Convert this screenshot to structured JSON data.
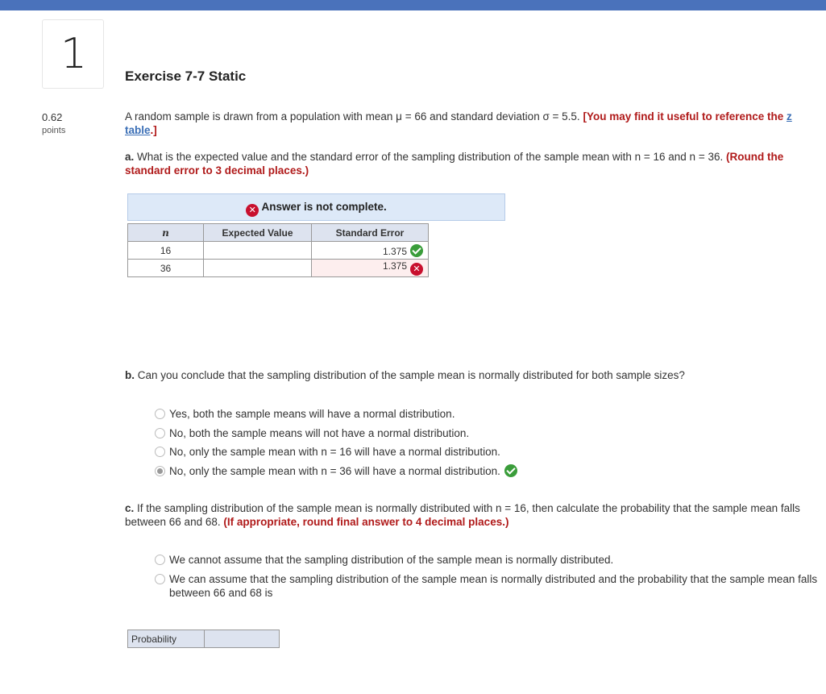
{
  "question_number": "1",
  "title": "Exercise 7-7 Static",
  "points": {
    "value": "0.62",
    "label": "points"
  },
  "intro": {
    "text": "A random sample is drawn from a population with mean μ = 66 and standard deviation σ = 5.5.",
    "ref_prefix": "[You may find it useful to reference the",
    "ref_link": "z table",
    "ref_suffix": ".]"
  },
  "part_a": {
    "prefix": "a.",
    "question": "What is the expected value and the standard error of the sampling distribution of the sample mean with n = 16 and n = 36.",
    "instruction": "(Round the standard error to 3 decimal places.)",
    "banner": "Answer is not complete.",
    "table": {
      "headers": [
        "n",
        "Expected Value",
        "Standard Error"
      ],
      "rows": [
        {
          "n": "16",
          "expected_value": "",
          "standard_error": "1.375",
          "status": "correct"
        },
        {
          "n": "36",
          "expected_value": "",
          "standard_error": "1.375",
          "status": "incorrect"
        }
      ]
    }
  },
  "part_b": {
    "prefix": "b.",
    "question": "Can you conclude that the sampling distribution of the sample mean is normally distributed for both sample sizes?",
    "options": [
      {
        "label": "Yes, both the sample means will have a normal distribution.",
        "selected": false
      },
      {
        "label": "No, both the sample means will not have a normal distribution.",
        "selected": false
      },
      {
        "label": "No, only the sample mean with n = 16 will have a normal distribution.",
        "selected": false
      },
      {
        "label": "No, only the sample mean with n = 36 will have a normal distribution.",
        "selected": true,
        "status": "correct"
      }
    ]
  },
  "part_c": {
    "prefix": "c.",
    "question": "If the sampling distribution of the sample mean is normally distributed with n = 16, then calculate the probability that the sample mean falls between 66 and 68.",
    "instruction": "(If appropriate, round final answer to 4 decimal places.)",
    "options": [
      {
        "label": "We cannot assume that the sampling distribution of the sample mean is normally distributed.",
        "selected": false
      },
      {
        "label": "We can assume that the sampling distribution of the sample mean is normally distributed and the probability that the sample mean falls between 66 and 68 is",
        "selected": false
      }
    ],
    "probability_label": "Probability",
    "probability_value": ""
  },
  "colors": {
    "header_bar": "#4a72bb",
    "emphasis_red": "#b01a1a",
    "correct_green": "#3a9d3a",
    "incorrect_red": "#c8102e",
    "banner_bg": "#dde9f8"
  },
  "icons": {
    "correct": "check-circle-icon",
    "incorrect": "x-circle-icon"
  }
}
